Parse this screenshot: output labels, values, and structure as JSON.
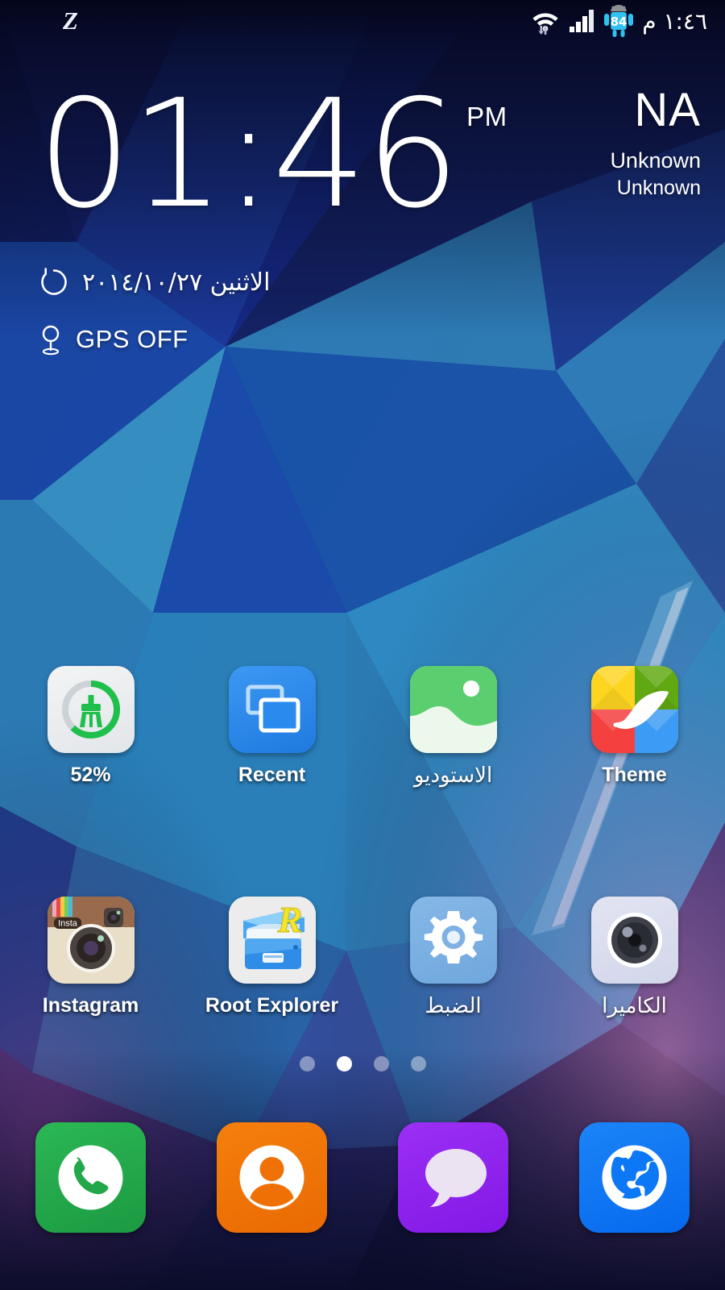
{
  "statusbar": {
    "notification_icon": "zedge-z-icon",
    "notification_label": "Z",
    "icons": [
      "wifi-icon",
      "signal-bars-icon",
      "battery-android-icon"
    ],
    "battery_level": "84",
    "time": "١:٤٦ م"
  },
  "widget": {
    "clock_time": "01:46",
    "clock_ampm": "PM",
    "weather_temp": "NA",
    "weather_condition": "Unknown",
    "weather_location": "Unknown",
    "date": "الاثنين ٢٠١٤/١٠/٢٧",
    "refresh_icon": "refresh-circle-icon",
    "gps_icon": "location-pin-icon",
    "gps_status": "GPS OFF"
  },
  "apps": {
    "row1": [
      {
        "label": "52%",
        "icon": "phone-cleaner-icon",
        "rtl": false
      },
      {
        "label": "Recent",
        "icon": "recent-apps-icon",
        "rtl": false
      },
      {
        "label": "الاستوديو",
        "icon": "gallery-icon",
        "rtl": true
      },
      {
        "label": "Theme",
        "icon": "theme-icon",
        "rtl": false
      }
    ],
    "row2": [
      {
        "label": "Instagram",
        "icon": "instagram-icon",
        "rtl": false
      },
      {
        "label": "Root Explorer",
        "icon": "root-explorer-icon",
        "rtl": false
      },
      {
        "label": "الضبط",
        "icon": "settings-gear-icon",
        "rtl": true
      },
      {
        "label": "الكاميرا",
        "icon": "camera-icon",
        "rtl": true
      }
    ],
    "cleaner_percent": 52
  },
  "pager": {
    "total_pages": 4,
    "active_page": 2
  },
  "dock": [
    {
      "name": "phone",
      "icon": "phone-handset-icon",
      "color": "#22a84a"
    },
    {
      "name": "contacts",
      "icon": "person-icon",
      "color": "#ef7106"
    },
    {
      "name": "messages",
      "icon": "speech-bubble-icon",
      "color": "#8e26ef"
    },
    {
      "name": "browser",
      "icon": "globe-icon",
      "color": "#0c78f5"
    }
  ],
  "colors": {
    "cleaner_green": "#1fbf4b",
    "recent_blue": "#2b8aee",
    "gallery_green": "#5bcf6f",
    "settings_blue": "#7bb2e3",
    "accent_white": "#ffffff"
  }
}
